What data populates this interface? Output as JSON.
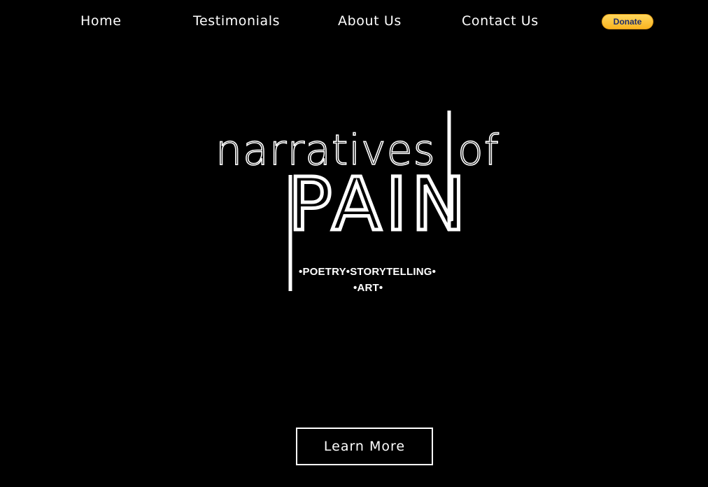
{
  "nav": {
    "items": [
      {
        "label": "Home"
      },
      {
        "label": "Testimonials"
      },
      {
        "label": "About Us"
      },
      {
        "label": "Contact Us"
      }
    ],
    "donate_label": "Donate"
  },
  "logo": {
    "line1": "narratives",
    "line1b": "of",
    "line2": "PAIN",
    "tagline1": "•POETRY•STORYTELLING•",
    "tagline2": "•ART•"
  },
  "hero": {
    "cta_label": "Learn More"
  },
  "colors": {
    "background": "#000000",
    "text": "#ffffff",
    "donate_bg": "#ffc439",
    "donate_text": "#1f2d6b"
  }
}
